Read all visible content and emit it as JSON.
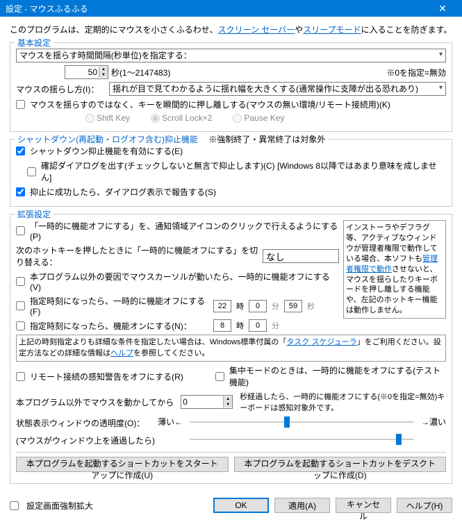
{
  "titlebar": {
    "title": "設定 - マウスふるふる"
  },
  "intro": {
    "pre": "このプログラムは、定期的にマウスを小さくふるわせ、",
    "link1": "スクリーン セーバー",
    "mid": "や",
    "link2": "スリープモード",
    "post": "に入ることを防ぎます。"
  },
  "basic": {
    "heading": "基本設定",
    "interval_label": "マウスを揺らす時間間隔(秒単位)を指定する：",
    "interval_value": "50",
    "interval_suffix": "秒(1～2147483)",
    "zero_note": "※0を指定=無効",
    "shake_method_label": "マウスの揺らし方(I)：",
    "shake_method_value": "揺れが目で見てわかるように揺れ幅を大きくする(通常操作に支障が出る恐れあり)",
    "alt_keypress": "マウスを揺らすのではなく、キーを瞬間的に押し離しする(マウスの無い環境/リモート接続用)(K)",
    "radio_shift": "Shift Key",
    "radio_scroll": "Scroll Lock×2",
    "radio_pause": "Pause Key"
  },
  "shutdown": {
    "heading_pre": "シャットダウン(再起動・ログオフ含む)抑止機能",
    "heading_note": "※強制終了・異常終了は対象外",
    "enable": "シャットダウン抑止機能を有効にする(E)",
    "confirm": "確認ダイアログを出す(チェックしないと無言で抑止します)(C) [Windows 8以降ではあまり意味を成しません]",
    "report": "抑止に成功したら、ダイアログ表示で報告する(S)"
  },
  "ext": {
    "heading": "拡張設定",
    "tray_toggle": "「一時的に機能オフにする」を、通知領域アイコンのクリックで行えるようにする(P)",
    "hotkey_label": "次のホットキーを押したときに「一時的に機能オフにする」を切り替える：",
    "hotkey_value": "なし",
    "other_cursor": "本プログラム以外の要因でマウスカーソルが動いたら、一時的に機能オフにする(V)",
    "time_off": "指定時刻になったら、一時的に機能オフにする(F)",
    "time_on": "指定時刻になったら、機能オンにする(N)：",
    "t1_h": "22",
    "t1_m": "0",
    "t1_s": "59",
    "t2_h": "8",
    "t2_m": "0",
    "unit_h": "時",
    "unit_m": "分",
    "unit_s": "秒",
    "detail_pre": "上記の時刻指定よりも詳細な条件を指定したい場合は、Windows標準付属の「",
    "detail_link": "タスク スケジューラ",
    "detail_mid": "」をご利用ください。設定方法などの詳細な情報は",
    "detail_help": "ヘルプ",
    "detail_post": "を参照してください。",
    "sidebar": "インストーラやデフラグ等、アクティブなウィンドウが管理者権限で動作している場合、本ソフトも管理者権限で動作させないと、マウスを揺らしたりキーボードを押し離しする機能や、左記のホットキー機能は動作しません。",
    "sidebar_link": "管理者権限で動作",
    "remote_warn": "リモート接続の感知警告をオフにする(R)",
    "focus_mode": "集中モードのときは、一時的に機能をオフにする(テスト機能)",
    "idle_label": "本プログラム以外でマウスを動かしてから",
    "idle_value": "0",
    "idle_suffix": "秒経過したら、一時的に機能オフにする(※0を指定=無効)キーボードは感知対象外です。",
    "opacity_label": "状態表示ウィンドウの透明度(O)：",
    "opacity_sub": "(マウスがウィンドウ上を通過したら)",
    "slider_thin": "薄い←",
    "slider_thick": "→濃い",
    "btn_startup": "本プログラムを起動するショートカットをスタートアップに作成(U)",
    "btn_desktop": "本プログラムを起動するショートカットをデスクトップに作成(D)"
  },
  "footer": {
    "force_expand": "設定画面強制拡大",
    "ok": "OK",
    "apply": "適用(A)",
    "cancel": "キャンセル",
    "help": "ヘルプ(H)"
  }
}
